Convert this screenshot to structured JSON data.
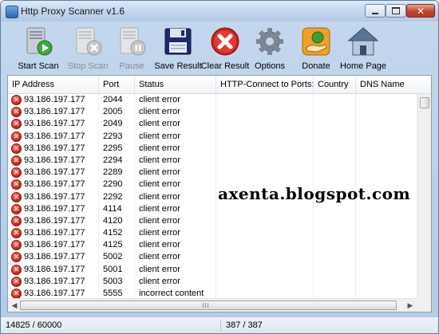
{
  "window": {
    "title": "Http Proxy Scanner v1.6"
  },
  "toolbar": {
    "items": [
      {
        "label": "Start Scan",
        "enabled": true,
        "icon": "server-start-icon"
      },
      {
        "label": "Stop Scan",
        "enabled": false,
        "icon": "server-stop-icon"
      },
      {
        "label": "Pause",
        "enabled": false,
        "icon": "server-pause-icon"
      },
      {
        "label": "Save Result",
        "enabled": true,
        "icon": "floppy-disk-icon"
      },
      {
        "label": "Clear Result",
        "enabled": true,
        "icon": "red-x-icon"
      },
      {
        "label": "Options",
        "enabled": true,
        "icon": "gear-icon"
      },
      {
        "label": "Donate",
        "enabled": true,
        "icon": "donate-hand-icon"
      },
      {
        "label": "Home Page",
        "enabled": true,
        "icon": "house-icon"
      }
    ]
  },
  "table": {
    "columns": [
      "IP Address",
      "Port",
      "Status",
      "HTTP-Connect to Ports:",
      "Country",
      "DNS Name"
    ],
    "rows": [
      {
        "ip": "93.186.197.177",
        "port": "2044",
        "status": "client error"
      },
      {
        "ip": "93.186.197.177",
        "port": "2005",
        "status": "client error"
      },
      {
        "ip": "93.186.197.177",
        "port": "2049",
        "status": "client error"
      },
      {
        "ip": "93.186.197.177",
        "port": "2293",
        "status": "client error"
      },
      {
        "ip": "93.186.197.177",
        "port": "2295",
        "status": "client error"
      },
      {
        "ip": "93.186.197.177",
        "port": "2294",
        "status": "client error"
      },
      {
        "ip": "93.186.197.177",
        "port": "2289",
        "status": "client error"
      },
      {
        "ip": "93.186.197.177",
        "port": "2290",
        "status": "client error"
      },
      {
        "ip": "93.186.197.177",
        "port": "2292",
        "status": "client error"
      },
      {
        "ip": "93.186.197.177",
        "port": "4114",
        "status": "client error"
      },
      {
        "ip": "93.186.197.177",
        "port": "4120",
        "status": "client error"
      },
      {
        "ip": "93.186.197.177",
        "port": "4152",
        "status": "client error"
      },
      {
        "ip": "93.186.197.177",
        "port": "4125",
        "status": "client error"
      },
      {
        "ip": "93.186.197.177",
        "port": "5002",
        "status": "client error"
      },
      {
        "ip": "93.186.197.177",
        "port": "5001",
        "status": "client error"
      },
      {
        "ip": "93.186.197.177",
        "port": "5003",
        "status": "client error"
      },
      {
        "ip": "93.186.197.177",
        "port": "5555",
        "status": "incorrect content"
      }
    ]
  },
  "watermark": "axenta.blogspot.com",
  "statusbar": {
    "progress": "14825 / 60000",
    "count": "387 / 387"
  }
}
